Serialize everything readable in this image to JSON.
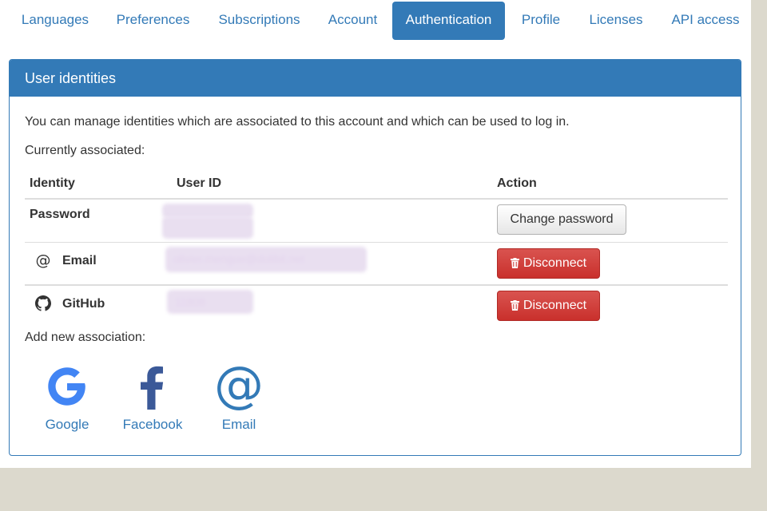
{
  "tabs": [
    {
      "label": "Languages",
      "active": false
    },
    {
      "label": "Preferences",
      "active": false
    },
    {
      "label": "Subscriptions",
      "active": false
    },
    {
      "label": "Account",
      "active": false
    },
    {
      "label": "Authentication",
      "active": true
    },
    {
      "label": "Profile",
      "active": false
    },
    {
      "label": "Licenses",
      "active": false
    },
    {
      "label": "API access",
      "active": false
    }
  ],
  "panel": {
    "title": "User identities",
    "intro": "You can manage identities which are associated to this account and which can be used to log in.",
    "current_label": "Currently associated:",
    "add_label": "Add new association:"
  },
  "table": {
    "headers": {
      "identity": "Identity",
      "user_id": "User ID",
      "action": "Action"
    },
    "rows": [
      {
        "identity": "Password",
        "icon": "",
        "user_id": "",
        "action": "Change password"
      },
      {
        "identity": "Email",
        "icon": "at-icon",
        "user_id": "olivier.mengue@dolibit.net",
        "action": "Disconnect"
      },
      {
        "identity": "GitHub",
        "icon": "github-icon",
        "user_id": "11808",
        "action": "Disconnect"
      }
    ]
  },
  "providers": [
    {
      "label": "Google",
      "icon": "google-icon"
    },
    {
      "label": "Facebook",
      "icon": "facebook-icon"
    },
    {
      "label": "Email",
      "icon": "at-icon"
    }
  ],
  "colors": {
    "primary": "#337ab7",
    "danger": "#d9534f",
    "background": "#dcd9cd",
    "google_blue": "#4285f4",
    "facebook_blue": "#3b5998"
  }
}
